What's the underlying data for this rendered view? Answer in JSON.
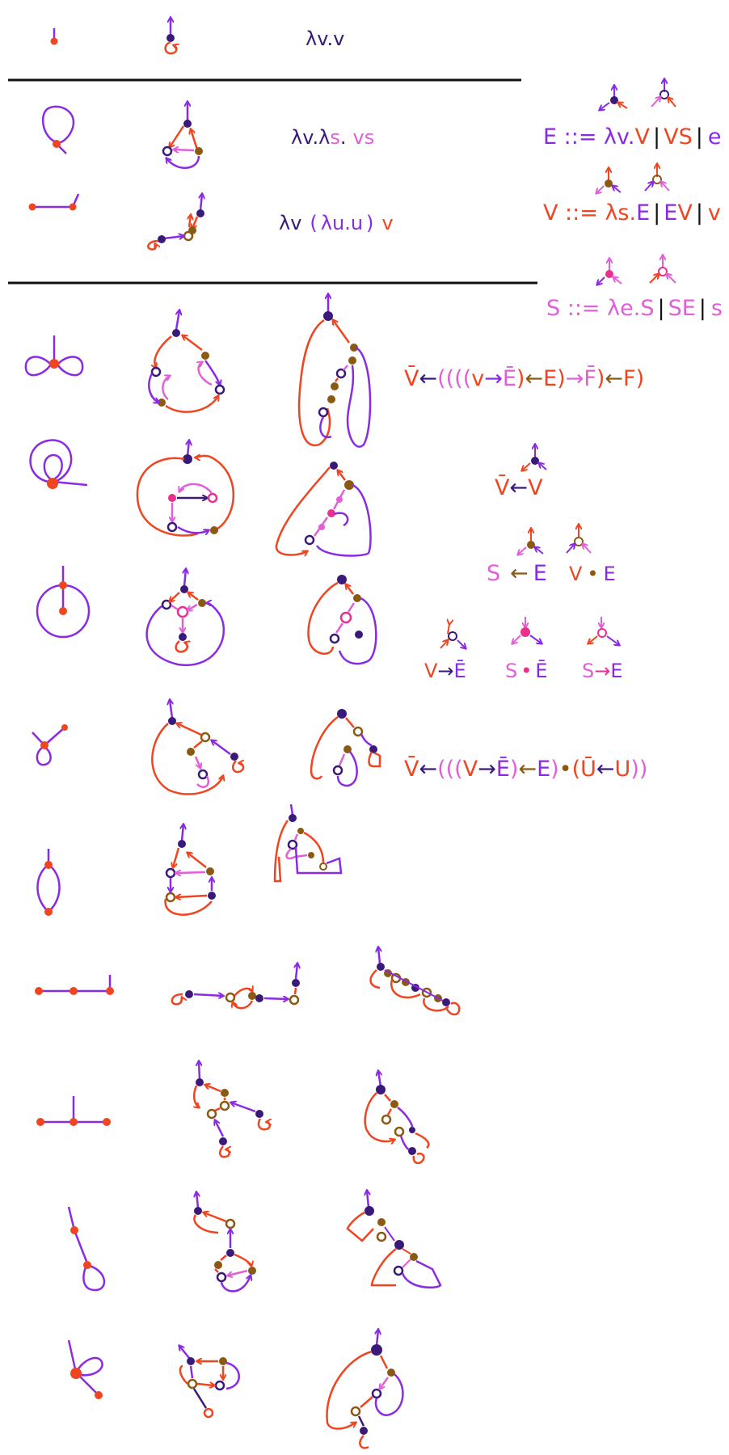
{
  "colors": {
    "purple": "#8a2be2",
    "navy": "#3a1a78",
    "orange": "#ef4520",
    "pink": "#e060d8",
    "magenta": "#e8308c",
    "brown": "#8b5a12",
    "black": "#111111"
  },
  "row1": {
    "term": "λv.v"
  },
  "row2": {
    "term_prefix": "λv.λ",
    "term_s": "s",
    "term_dot": ".",
    "term_vs": "vs"
  },
  "row3": {
    "term_lam": "λv",
    "term_paren_open": "(",
    "term_inner": "λu.u",
    "term_paren_close": ")",
    "term_v": "v"
  },
  "grammar": {
    "E_rule": {
      "head": "E ::= ",
      "lam": "λv.",
      "body_v": "V",
      "sep1": "|",
      "app": "VS",
      "sep2": "|",
      "var": "e"
    },
    "V_rule": {
      "head": "V ::= ",
      "lam": "λs.",
      "body": "E",
      "sep1": "|",
      "app_e": "E",
      "app_v": "V",
      "sep2": "|",
      "var": "v"
    },
    "S_rule": {
      "head": "S ::= ",
      "lam": "λe.",
      "body": "S",
      "sep1": "|",
      "app": "SE",
      "sep2": "|",
      "var": "s"
    }
  },
  "type_row4": {
    "vbar": "V̄",
    "arrow1": "←",
    "parens": "((((",
    "v": "v",
    "arrow2": "→",
    "ebar": "Ē",
    "close1": ")",
    "arrow3": "←",
    "e": "E",
    "close2": ")",
    "arrow4": "→",
    "fbar": "F̄",
    "close3": ")",
    "arrow5": "←",
    "f": "F",
    "close4": ")"
  },
  "legend": {
    "vbar_v": {
      "left": "V̄",
      "arrow": "←",
      "right": "V"
    },
    "s_e": {
      "left": "S",
      "arrow": "←",
      "right": "E"
    },
    "v_e": {
      "left": "V",
      "dot": "•",
      "right": "E"
    },
    "v_ebar": {
      "left": "V",
      "arrow": "→",
      "right": "Ē"
    },
    "s_ebar": {
      "left": "S",
      "dot": "•",
      "right": "Ē"
    },
    "s_e2": {
      "left": "S",
      "arrow": "→",
      "right": "E"
    }
  },
  "type_row7": {
    "vbar": "V̄",
    "arrow1": "←",
    "parens": "(((",
    "v": "V",
    "arrow2": "→",
    "ebar": "Ē",
    "close1": ")",
    "arrow3": "←",
    "e": "E",
    "close2": ")",
    "dot": "•",
    "open3": "(",
    "ubar": "Ū",
    "arrow4": "←",
    "u": "U",
    "close3": "))"
  }
}
